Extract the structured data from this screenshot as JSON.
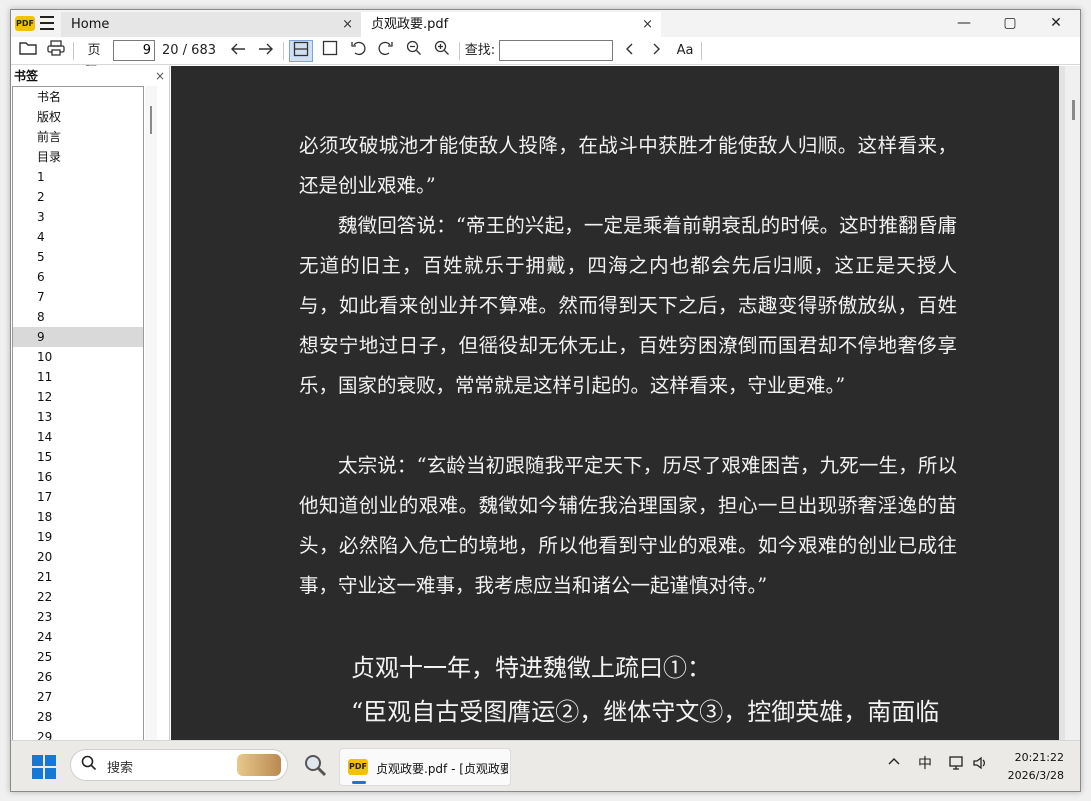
{
  "titlebar": {
    "app_logo": "PDF",
    "tabs": [
      {
        "label": "Home",
        "close": "×"
      },
      {
        "label": "贞观政要.pdf",
        "close": "×"
      }
    ],
    "controls": {
      "minimize": "—",
      "maximize": "▢",
      "close": "✕"
    }
  },
  "toolbar": {
    "page_label": "页码:",
    "page_value": "9",
    "page_count": "20 / 683",
    "search_label": "查找:",
    "search_value": "",
    "case_label": "Aa"
  },
  "sidebar": {
    "title": "书签",
    "close": "×",
    "items": [
      "书名",
      "版权",
      "前言",
      "目录",
      "1",
      "2",
      "3",
      "4",
      "5",
      "6",
      "7",
      "8",
      "9",
      "10",
      "11",
      "12",
      "13",
      "14",
      "15",
      "16",
      "17",
      "18",
      "19",
      "20",
      "21",
      "22",
      "23",
      "24",
      "25",
      "26",
      "27",
      "28",
      "29"
    ],
    "selected": "9"
  },
  "document": {
    "paragraphs": [
      "必须攻破城池才能使敌人投降，在战斗中获胜才能使敌人归顺。这样看来，还是创业艰难。”",
      "魏徵回答说：“帝王的兴起，一定是乘着前朝衰乱的时候。这时推翻昏庸无道的旧主，百姓就乐于拥戴，四海之内也都会先后归顺，这正是天授人与，如此看来创业并不算难。然而得到天下之后，志趣变得骄傲放纵，百姓想安宁地过日子，但徭役却无休无止，百姓穷困潦倒而国君却不停地奢侈享乐，国家的衰败，常常就是这样引起的。这样看来，守业更难。”",
      "太宗说：“玄龄当初跟随我平定天下，历尽了艰难困苦，九死一生，所以他知道创业的艰难。魏徵如今辅佐我治理国家，担心一旦出现骄奢淫逸的苗头，必然陷入危亡的境地，所以他看到守业的艰难。如今艰难的创业已成往事，守业这一难事，我考虑应当和诸公一起谨慎对待。”"
    ],
    "heading_1": "贞观十一年，特进魏徵上疏曰①：",
    "heading_2": "“臣观自古受图膺运②，继体守文③，控御英雄，南面临"
  },
  "taskbar": {
    "search_label": "搜索",
    "running_app": "贞观政要.pdf - [贞观政要",
    "running_logo": "PDF",
    "ime": "中",
    "time": "20:21:22",
    "date": "2026/3/28"
  }
}
